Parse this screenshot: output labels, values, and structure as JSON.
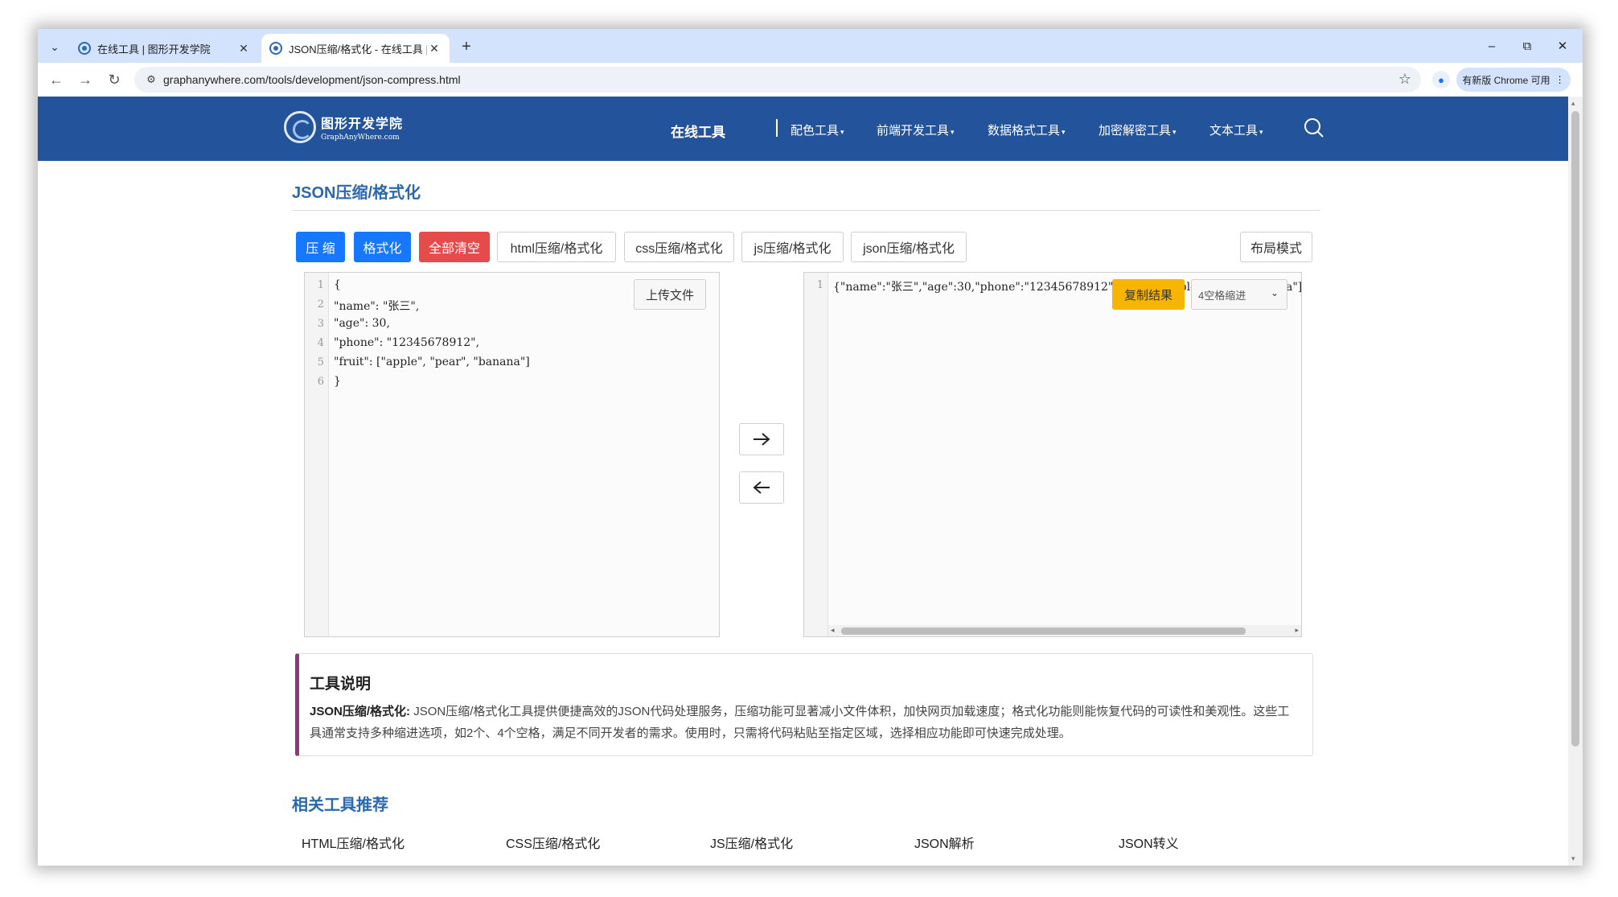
{
  "browser": {
    "tabs": [
      {
        "title": "在线工具 | 图形开发学院",
        "active": false
      },
      {
        "title": "JSON压缩/格式化 - 在线工具 |",
        "active": true
      }
    ],
    "url": "graphanywhere.com/tools/development/json-compress.html",
    "update_chip": "有新版 Chrome 可用",
    "window_controls": [
      "–",
      "⧉",
      "✕"
    ]
  },
  "site": {
    "logo_cn": "图形开发学院",
    "logo_en": "GraphAnyWhere.com",
    "section_title": "在线工具",
    "nav": [
      "配色工具",
      "前端开发工具",
      "数据格式工具",
      "加密解密工具",
      "文本工具"
    ]
  },
  "page": {
    "title": "JSON压缩/格式化",
    "buttons": {
      "compress": "压 缩",
      "format": "格式化",
      "clear": "全部清空",
      "html": "html压缩/格式化",
      "css": "css压缩/格式化",
      "js": "js压缩/格式化",
      "json": "json压缩/格式化",
      "layout": "布局模式"
    },
    "input_editor": {
      "upload_label": "上传文件",
      "lines": [
        "{",
        "\"name\": \"张三\",",
        "\"age\": 30,",
        "\"phone\": \"12345678912\",",
        "\"fruit\": [\"apple\", \"pear\", \"banana\"]",
        "}"
      ]
    },
    "output_editor": {
      "copy_label": "复制结果",
      "indent_label": "4空格缩进",
      "lines": [
        "{\"name\":\"张三\",\"age\":30,\"phone\":\"12345678912\",\"fruit\":[\"apple\",\"pear\",\"banana\"]}"
      ]
    },
    "description": {
      "heading": "工具说明",
      "lead": "JSON压缩/格式化:",
      "text": "JSON压缩/格式化工具提供便捷高效的JSON代码处理服务，压缩功能可显著减小文件体积，加快网页加载速度；格式化功能则能恢复代码的可读性和美观性。这些工具通常支持多种缩进选项，如2个、4个空格，满足不同开发者的需求。使用时，只需将代码粘贴至指定区域，选择相应功能即可快速完成处理。"
    },
    "related": {
      "title": "相关工具推荐",
      "links": [
        "HTML压缩/格式化",
        "CSS压缩/格式化",
        "JS压缩/格式化",
        "JSON解析",
        "JSON转义"
      ]
    }
  }
}
